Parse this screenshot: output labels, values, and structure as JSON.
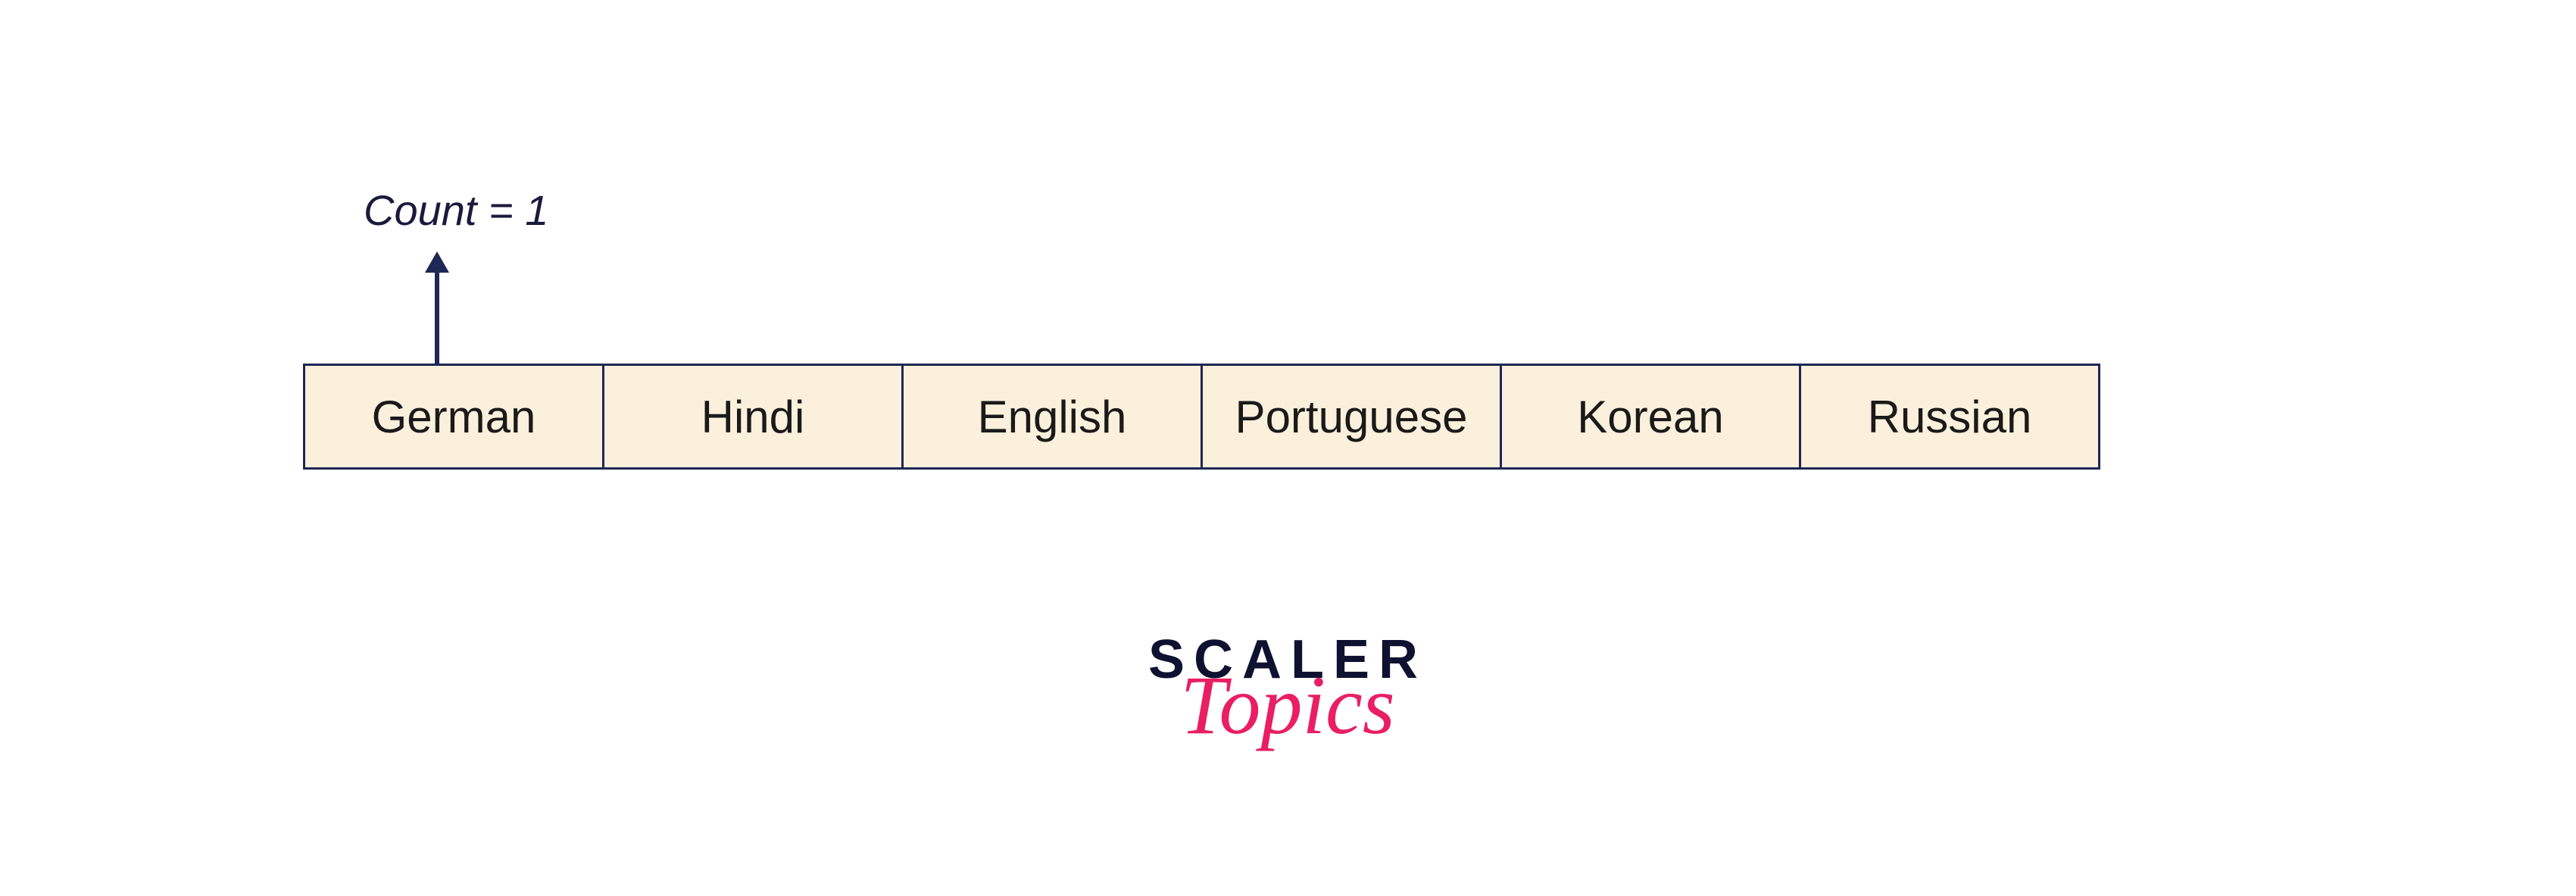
{
  "diagram": {
    "count_label": "Count = 1",
    "cells": [
      "German",
      "Hindi",
      "English",
      "Portuguese",
      "Korean",
      "Russian"
    ]
  },
  "logo": {
    "line1": "SCALER",
    "line2": "Topics"
  },
  "colors": {
    "cell_bg": "#fbf0db",
    "cell_border": "#1f2756",
    "arrow": "#1f2756",
    "logo_dark": "#0e1230",
    "logo_pink": "#e91e63"
  }
}
